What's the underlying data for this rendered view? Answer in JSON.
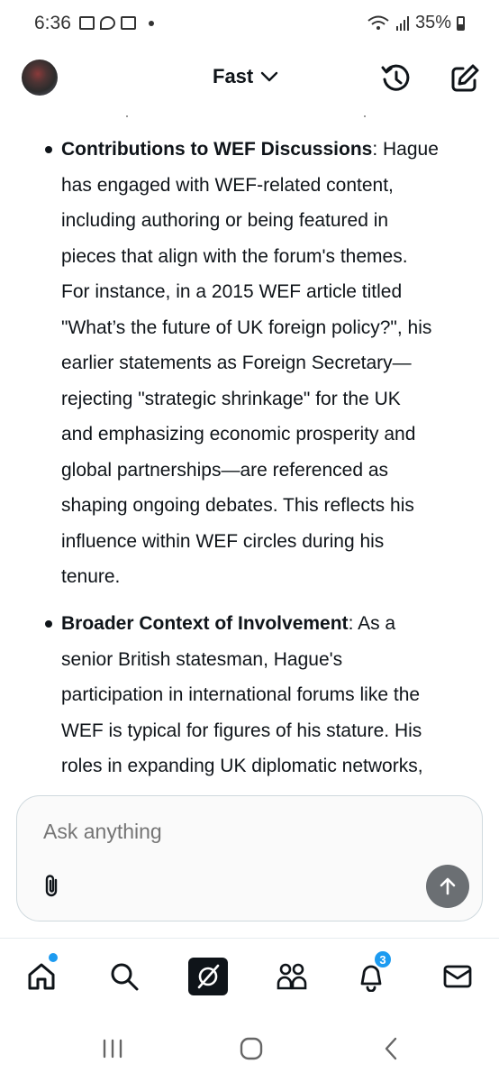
{
  "status_bar": {
    "time": "6:36",
    "battery": "35%"
  },
  "header": {
    "mode_label": "Fast",
    "icons": [
      "avatar",
      "chevron-down-icon",
      "history-icon",
      "compose-icon"
    ]
  },
  "content": {
    "bullets": [
      {
        "title": "Contributions to WEF Discussions",
        "lines": [
          "Hague",
          "has engaged with WEF-related content,",
          "including authoring or being featured in",
          "pieces that align with the forum's themes.",
          "For instance, in a 2015 WEF article titled",
          "\"What’s the future of UK foreign policy?\", his",
          "earlier statements as Foreign Secretary—",
          "rejecting \"strategic shrinkage\" for the UK",
          "and emphasizing economic prosperity and",
          "global partnerships—are referenced as",
          "shaping ongoing debates. This reflects his",
          "influence within WEF circles during his",
          "tenure."
        ]
      },
      {
        "title": "Broader Context of Involvement",
        "lines": [
          "As a",
          "senior British statesman, Hague's",
          "participation in international forums like the",
          "WEF is typical for figures of his stature. His",
          "roles in expanding UK diplomatic networks,"
        ]
      }
    ]
  },
  "ask_box": {
    "placeholder": "Ask anything"
  },
  "bottom_nav": {
    "items": [
      "home-icon",
      "search-icon",
      "grok-icon",
      "communities-icon",
      "notifications-icon",
      "messages-icon"
    ],
    "notifications_badge": "3",
    "accent_color": "#1d9bf0"
  }
}
